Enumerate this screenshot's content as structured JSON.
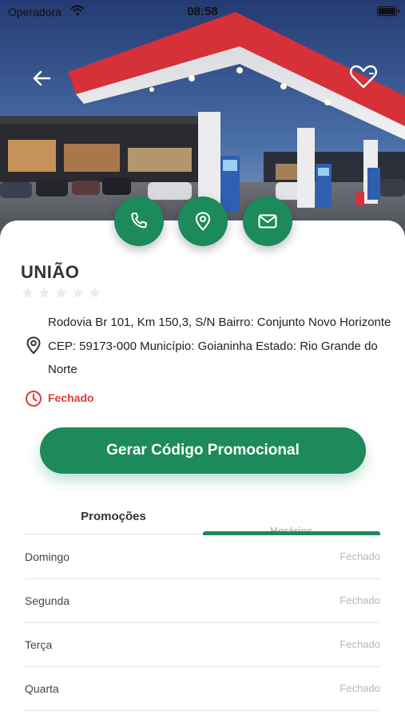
{
  "status_bar": {
    "carrier": "Operadora",
    "time": "08:58"
  },
  "station": {
    "name": "UNIÃO",
    "rating": 0,
    "max_rating": 5,
    "address": "Rodovia Br 101, Km 150,3, S/N Bairro: Conjunto Novo Horizonte CEP: 59173-000 Município: Goianinha Estado: Rio Grande do Norte",
    "status": "Fechado"
  },
  "actions": {
    "promo_button": "Gerar Código Promocional"
  },
  "tabs": [
    {
      "label": "Promoções",
      "active": false
    },
    {
      "label": "Horários",
      "active": true
    }
  ],
  "schedule": [
    {
      "day": "Domingo",
      "hours": "Fechado"
    },
    {
      "day": "Segunda",
      "hours": "Fechado"
    },
    {
      "day": "Terça",
      "hours": "Fechado"
    },
    {
      "day": "Quarta",
      "hours": "Fechado"
    }
  ],
  "icons": {
    "back": "arrow-left-icon",
    "favorite": "heart-outline-icon",
    "phone": "phone-icon",
    "map": "map-pin-icon",
    "mail": "mail-icon",
    "location": "map-pin-icon",
    "clock": "clock-icon",
    "star": "star-icon"
  },
  "colors": {
    "primary": "#1c8a5a",
    "closed": "#dc3b3b",
    "muted": "#b7b7b7"
  }
}
